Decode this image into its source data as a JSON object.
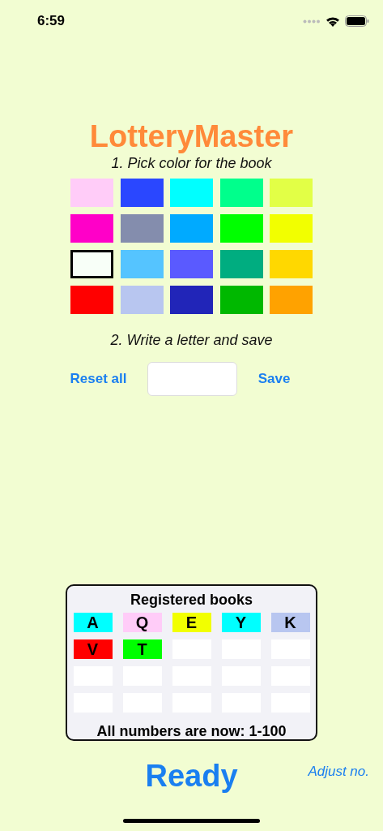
{
  "status_bar": {
    "time": "6:59"
  },
  "title": "LotteryMaster",
  "step_1": "1. Pick color for the book",
  "swatches": [
    {
      "color": "#ffccf8",
      "selected": false
    },
    {
      "color": "#2a47ff",
      "selected": false
    },
    {
      "color": "#00ffff",
      "selected": false
    },
    {
      "color": "#00ff8c",
      "selected": false
    },
    {
      "color": "#e2ff46",
      "selected": false
    },
    {
      "color": "#ff00c8",
      "selected": false
    },
    {
      "color": "#848dad",
      "selected": false
    },
    {
      "color": "#00aaff",
      "selected": false
    },
    {
      "color": "#00ff00",
      "selected": false
    },
    {
      "color": "#f2ff00",
      "selected": false
    },
    {
      "color": "#f8fff8",
      "selected": true
    },
    {
      "color": "#55c4ff",
      "selected": false
    },
    {
      "color": "#5a5aff",
      "selected": false
    },
    {
      "color": "#00ad80",
      "selected": false
    },
    {
      "color": "#ffd800",
      "selected": false
    },
    {
      "color": "#ff0000",
      "selected": false
    },
    {
      "color": "#b8c6f0",
      "selected": false
    },
    {
      "color": "#2125b8",
      "selected": false
    },
    {
      "color": "#00b800",
      "selected": false
    },
    {
      "color": "#ffa200",
      "selected": false
    }
  ],
  "step_2": "2. Write a letter and save",
  "reset_button": "Reset all",
  "save_button": "Save",
  "registered": {
    "title": "Registered books",
    "slots": [
      {
        "kind": "book",
        "letter": "A",
        "color": "#00ffff"
      },
      {
        "kind": "book",
        "letter": "Q",
        "color": "#ffccf8"
      },
      {
        "kind": "book",
        "letter": "E",
        "color": "#f2ff00"
      },
      {
        "kind": "book",
        "letter": "Y",
        "color": "#00ffff"
      },
      {
        "kind": "book",
        "letter": "K",
        "color": "#b8c6f0"
      },
      {
        "kind": "book",
        "letter": "V",
        "color": "#ff0000"
      },
      {
        "kind": "book",
        "letter": "T",
        "color": "#00ff00"
      },
      {
        "kind": "empty"
      },
      {
        "kind": "empty"
      },
      {
        "kind": "empty"
      },
      {
        "kind": "empty"
      },
      {
        "kind": "empty"
      },
      {
        "kind": "empty"
      },
      {
        "kind": "empty"
      },
      {
        "kind": "empty"
      },
      {
        "kind": "empty"
      },
      {
        "kind": "empty"
      },
      {
        "kind": "empty"
      },
      {
        "kind": "empty"
      },
      {
        "kind": "empty"
      }
    ],
    "footer": "All numbers are now: 1-100"
  },
  "status": "Ready",
  "adjust_link": "Adjust no."
}
